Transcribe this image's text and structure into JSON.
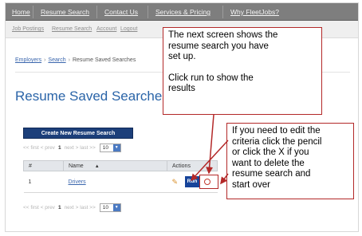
{
  "top_nav": [
    "Home",
    "Resume Search",
    "Contact Us",
    "Services & Pricing",
    "Why FleetJobs?"
  ],
  "sub_nav": [
    "Job Postings",
    "Resume Search",
    "Account",
    "Logout"
  ],
  "breadcrumb": {
    "employers": "Employers",
    "search": "Search",
    "current": "Resume Saved Searches"
  },
  "page_title": "Resume Saved Searches",
  "create_button": "Create New Resume Search",
  "pager": {
    "first": "<< first",
    "prev": "< prev",
    "current": "1",
    "next": "next >",
    "last": "last >>",
    "per_page": "10"
  },
  "table": {
    "headers": {
      "num": "#",
      "name": "Name",
      "actions": "Actions"
    },
    "rows": [
      {
        "num": "1",
        "name": "Drivers",
        "run": "Run"
      }
    ]
  },
  "callout_top": {
    "line1": "The next screen shows the",
    "line2": "resume search you have",
    "line3": "set up.",
    "line4": "Click run to show the",
    "line5": "results"
  },
  "callout_right": {
    "line1": "If you need to edit the",
    "line2": "criteria click the pencil",
    "line3": "or click the X if you",
    "line4": "want to delete the",
    "line5": "resume search and",
    "line6": "start over"
  },
  "colors": {
    "nav": "#7e7e7e",
    "title": "#2a64a8",
    "button": "#1c3f7a",
    "callout_border": "#b32828"
  }
}
